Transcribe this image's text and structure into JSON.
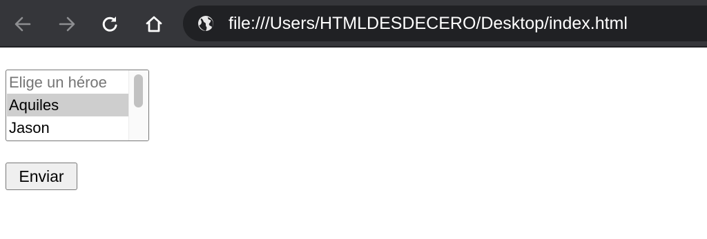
{
  "browser": {
    "url": "file:///Users/HTMLDESDECERO/Desktop/index.html",
    "icons": {
      "back": "arrow-left-icon",
      "forward": "arrow-right-icon",
      "reload": "reload-icon",
      "home": "home-icon",
      "site_info": "globe-icon"
    },
    "colors": {
      "toolbar": "#35363a",
      "omnibox": "#202124",
      "disabled_icon": "#8e8f92",
      "active_icon": "#ffffff"
    }
  },
  "form": {
    "hero_select": {
      "placeholder_option": "Elige un héroe",
      "options": [
        "Aquiles",
        "Jason"
      ],
      "selected": "Aquiles"
    },
    "submit_label": "Enviar"
  }
}
